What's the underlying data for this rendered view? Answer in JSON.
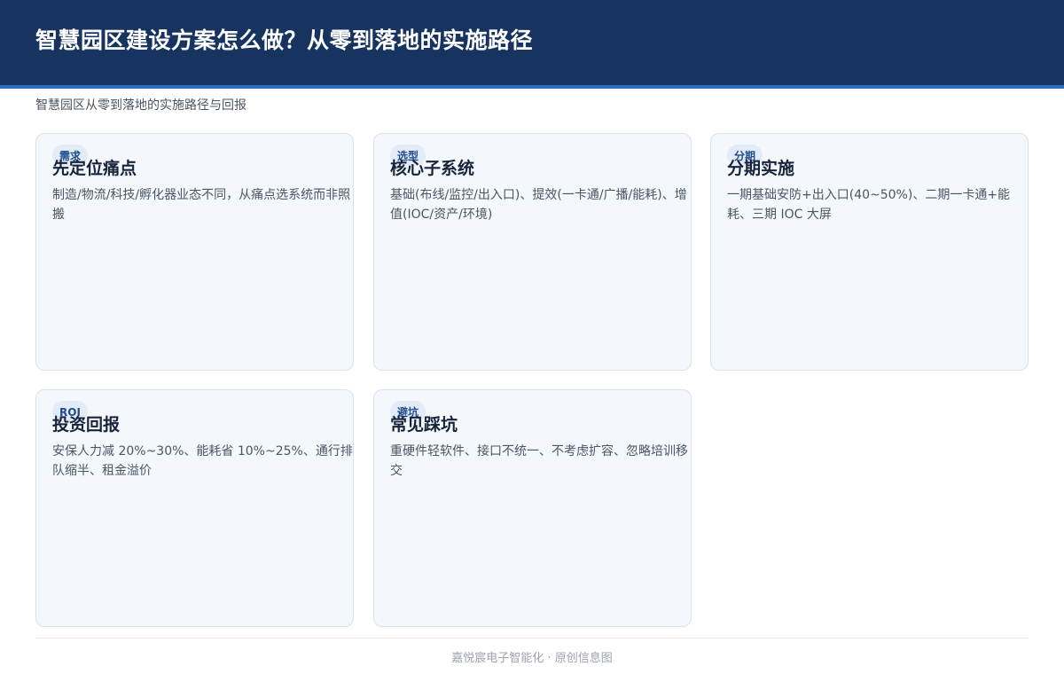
{
  "header": {
    "title": "智慧园区建设方案怎么做？从零到落地的实施路径"
  },
  "subtitle": "智慧园区从零到落地的实施路径与回报",
  "cards": [
    {
      "tag": "需求",
      "title": "先定位痛点",
      "desc": "制造/物流/科技/孵化器业态不同，从痛点选系统而非照搬"
    },
    {
      "tag": "选型",
      "title": "核心子系统",
      "desc": "基础(布线/监控/出入口)、提效(一卡通/广播/能耗)、增值(IOC/资产/环境)"
    },
    {
      "tag": "分期",
      "title": "分期实施",
      "desc": "一期基础安防+出入口(40~50%)、二期一卡通+能耗、三期 IOC 大屏"
    },
    {
      "tag": "ROI",
      "title": "投资回报",
      "desc": "安保人力减 20%~30%、能耗省 10%~25%、通行排队缩半、租金溢价"
    },
    {
      "tag": "避坑",
      "title": "常见踩坑",
      "desc": "重硬件轻软件、接口不统一、不考虑扩容、忽略培训移交"
    }
  ],
  "footer": "嘉悦宸电子智能化 · 原创信息图"
}
